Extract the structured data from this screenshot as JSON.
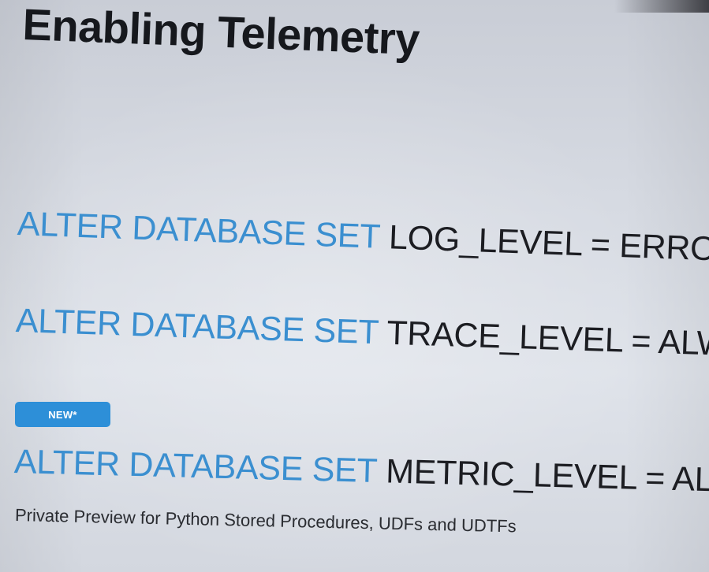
{
  "slide": {
    "title": "Enabling Telemetry",
    "lines": [
      {
        "keyword": "ALTER DATABASE SET",
        "argument": " LOG_LEVEL = ERROR;"
      },
      {
        "keyword": "ALTER DATABASE SET",
        "argument": " TRACE_LEVEL = ALWAYS"
      },
      {
        "keyword": "ALTER DATABASE SET",
        "argument": " METRIC_LEVEL = ALL;"
      }
    ],
    "badge": "NEW*",
    "note": "Private Preview for Python Stored Procedures, UDFs and UDTFs"
  },
  "colors": {
    "keyword": "#3b8fd0",
    "argument": "#1c1d22",
    "badge_bg": "#2d8fd8",
    "title": "#16181d"
  }
}
